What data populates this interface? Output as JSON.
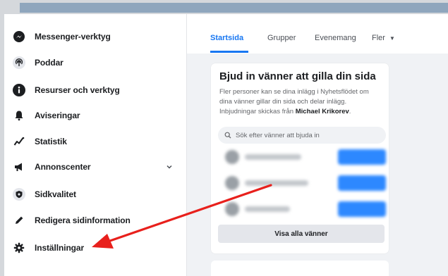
{
  "sidebar": {
    "items": [
      {
        "label": "Messenger-verktyg",
        "icon": "messenger-icon"
      },
      {
        "label": "Poddar",
        "icon": "podcast-icon"
      },
      {
        "label": "Resurser och verktyg",
        "icon": "info-icon"
      },
      {
        "label": "Aviseringar",
        "icon": "bell-icon"
      },
      {
        "label": "Statistik",
        "icon": "stats-icon"
      },
      {
        "label": "Annonscenter",
        "icon": "megaphone-icon"
      },
      {
        "label": "Sidkvalitet",
        "icon": "shield-icon"
      },
      {
        "label": "Redigera sidinformation",
        "icon": "pencil-icon"
      },
      {
        "label": "Inställningar",
        "icon": "gear-icon"
      }
    ]
  },
  "tabs": {
    "home": "Startsida",
    "groups": "Grupper",
    "events": "Evenemang",
    "more": "Fler"
  },
  "invite_card": {
    "title": "Bjud in vänner att gilla din sida",
    "description": "Fler personer kan se dina inlägg i Nyhetsflödet om dina vänner gillar din sida och delar inlägg. Inbjudningar skickas från ",
    "sender": "Michael Krikorev",
    "search_placeholder": "Sök efter vänner att bjuda in",
    "show_all": "Visa alla vänner"
  },
  "colors": {
    "accent": "#1877f2",
    "annotation": "#e8201c"
  }
}
